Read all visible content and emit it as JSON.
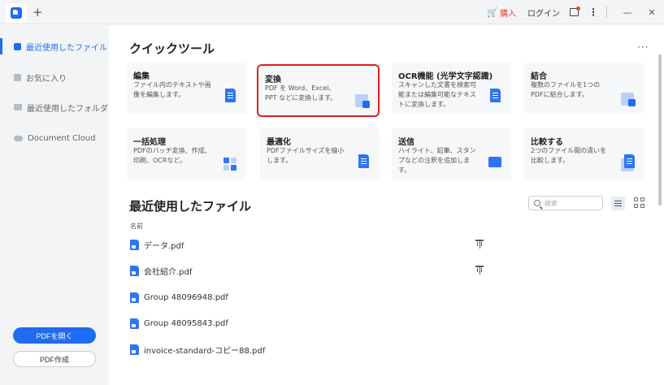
{
  "topbar": {
    "buy_label": "購入",
    "login_label": "ログイン",
    "minimize_glyph": "—",
    "close_glyph": "✕",
    "add_tab_glyph": "+",
    "more_glyph": "⋮"
  },
  "sidebar": {
    "items": [
      {
        "label": "最近使用したファイル",
        "icon": "recent-file-icon"
      },
      {
        "label": "お気に入り",
        "icon": "star-icon"
      },
      {
        "label": "最近使用したフォルダ",
        "icon": "folder-icon"
      },
      {
        "label": "Document Cloud",
        "icon": "cloud-icon"
      }
    ],
    "open_button": "PDFを開く",
    "create_button": "PDF作成"
  },
  "quick_tools": {
    "title": "クイックツール",
    "more_glyph": "···",
    "cards": [
      {
        "title": "編集",
        "desc": "ファイル内のテキストや画像を編集します。"
      },
      {
        "title": "変換",
        "desc": "PDF を Word、Excel、PPT などに変換します。"
      },
      {
        "title": "OCR機能 (光学文字認識)",
        "desc": "スキャンした文書を検索可能または編集可能なテキストに変換します。"
      },
      {
        "title": "結合",
        "desc": "複数のファイルを1つのPDFに結合します。"
      },
      {
        "title": "一括処理",
        "desc": "PDFのバッチ変換、作成、印刷、OCRなど。"
      },
      {
        "title": "最適化",
        "desc": "PDFファイルサイズを縮小します。"
      },
      {
        "title": "送信",
        "desc": "ハイライト、鉛筆、スタンプなどの注釈を追加します。"
      },
      {
        "title": "比較する",
        "desc": "2つのファイル間の違いを比較します。"
      }
    ]
  },
  "recent": {
    "title": "最近使用したファイル",
    "search_placeholder": "検索",
    "column_name": "名前",
    "files": [
      {
        "name": "データ.pdf",
        "pinned": true
      },
      {
        "name": "会社紹介.pdf",
        "pinned": true
      },
      {
        "name": "Group 48096948.pdf",
        "pinned": false
      },
      {
        "name": "Group 48095843.pdf",
        "pinned": false
      },
      {
        "name": "invoice-standard-コピー88.pdf",
        "pinned": false
      }
    ]
  },
  "colors": {
    "accent": "#1f6bf2",
    "selected_outline": "#e21f26",
    "buy": "#e0462f"
  }
}
